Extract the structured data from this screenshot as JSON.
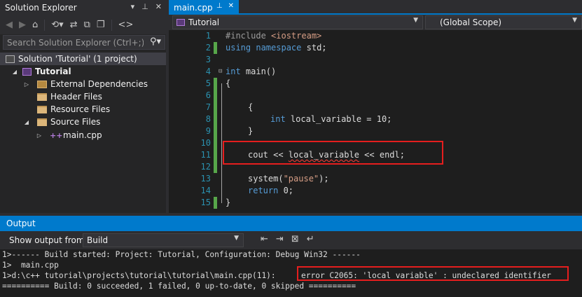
{
  "solution_explorer": {
    "title": "Solution Explorer",
    "search_placeholder": "Search Solution Explorer (Ctrl+;)",
    "tree": {
      "solution": "Solution 'Tutorial' (1 project)",
      "project": "Tutorial",
      "external": "External Dependencies",
      "header": "Header Files",
      "resource": "Resource Files",
      "source": "Source Files",
      "file": "main.cpp"
    }
  },
  "editor": {
    "tab_label": "main.cpp",
    "nav_left": "Tutorial",
    "nav_right": "(Global Scope)",
    "line_numbers": [
      "1",
      "2",
      "3",
      "4",
      "5",
      "6",
      "7",
      "8",
      "9",
      "10",
      "11",
      "12",
      "13",
      "14",
      "15"
    ],
    "code": {
      "l1_directive": "#include",
      "l1_header": "<iostream>",
      "l2_kw1": "using",
      "l2_kw2": "namespace",
      "l2_rest": " std;",
      "l4_kw": "int",
      "l4_rest": " main()",
      "l5": "{",
      "l7": "{",
      "l8_kw": "int",
      "l8_rest": " local_variable = 10;",
      "l9": "}",
      "l11_a": "cout << ",
      "l11_err": "local_variable",
      "l11_b": " << endl;",
      "l13_a": "system(",
      "l13_str": "\"pause\"",
      "l13_b": ");",
      "l14_kw": "return",
      "l14_rest": " 0;",
      "l15": "}"
    }
  },
  "output": {
    "title": "Output",
    "show_from_label": "Show output from:",
    "show_from_value": "Build",
    "lines": [
      "1>------ Build started: Project: Tutorial, Configuration: Debug Win32 ------",
      "1>  main.cpp",
      "1>d:\\c++ tutorial\\projects\\tutorial\\tutorial\\main.cpp(11):",
      "error C2065: 'local_variable' : undeclared identifier",
      "========== Build: 0 succeeded, 1 failed, 0 up-to-date, 0 skipped =========="
    ]
  },
  "colors": {
    "accent": "#007acc",
    "keyword": "#569cd6",
    "string": "#d69d85",
    "line_number": "#2b91af",
    "change_bar": "#57a64a",
    "highlight_box": "#e51e1e"
  }
}
